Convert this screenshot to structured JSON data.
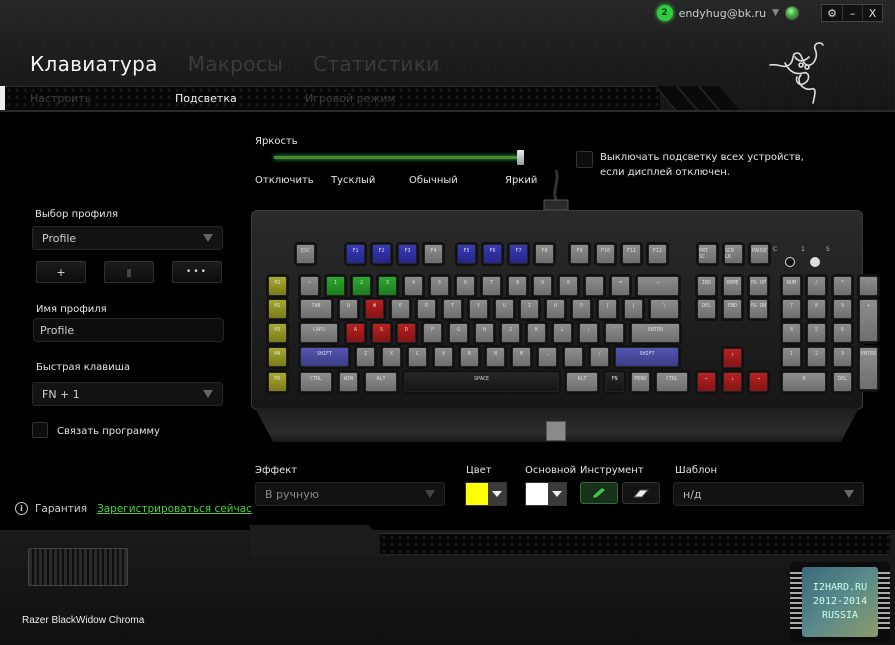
{
  "topbar": {
    "notification_count": "2",
    "account_email": "endyhug@bk.ru",
    "settings_icon": "gear-icon",
    "minimize_label": "–",
    "close_label": "X"
  },
  "main_tabs": [
    {
      "label": "Клавиатура",
      "active": true
    },
    {
      "label": "Макросы",
      "active": false
    },
    {
      "label": "Статистики",
      "active": false
    }
  ],
  "sub_tabs": [
    {
      "label": "Настроить",
      "active": false
    },
    {
      "label": "Подсветка",
      "active": true
    },
    {
      "label": "Игровой режим",
      "active": false
    }
  ],
  "brightness": {
    "label": "Яркость",
    "level_percent": 100,
    "marks": [
      "Отключить",
      "Тусклый",
      "Обычный",
      "Яркий"
    ]
  },
  "display_off_option": {
    "label": "Выключать подсветку всех устройств, если дисплей отключен.",
    "checked": false
  },
  "profile": {
    "select_label": "Выбор профиля",
    "selected": "Profile",
    "add_label": "+",
    "delete_icon": "trash-icon",
    "more_label": "•••",
    "name_label": "Имя профиля",
    "name_value": "Profile",
    "hotkey_label": "Быстрая клавиша",
    "hotkey_value": "FN + 1",
    "link_program_label": "Связать программу",
    "link_program_checked": false
  },
  "effect": {
    "label": "Эффект",
    "value": "В ручную"
  },
  "color": {
    "label": "Цвет",
    "value": "#ffff00"
  },
  "base": {
    "label": "Основной",
    "value": "#ffffff"
  },
  "tool": {
    "label": "Инструмент",
    "items": [
      "pencil-icon",
      "eraser-icon"
    ],
    "active": "pencil-icon"
  },
  "template": {
    "label": "Шаблон",
    "value": "н/д"
  },
  "warranty": {
    "label": "Гарантия",
    "link": "Зарегистрироваться сейчас"
  },
  "device": {
    "name": "Razer BlackWidow Chroma"
  },
  "keyboard": {
    "led_labels": [
      "C",
      "1",
      "S"
    ],
    "key_colors": {
      "blue": "#3030a8",
      "green": "#22a022",
      "red": "#b01818",
      "yellow": "#a0a020",
      "purple": "#4a4aa0",
      "default": "#7a7a7a"
    },
    "rows": [
      [
        {
          "k": "ESC",
          "c": "gray"
        },
        {
          "k": "F1",
          "c": "blue"
        },
        {
          "k": "F2",
          "c": "blue"
        },
        {
          "k": "F3",
          "c": "blue"
        },
        {
          "k": "F4",
          "c": "gray"
        },
        {
          "k": "F5",
          "c": "blue"
        },
        {
          "k": "F6",
          "c": "blue"
        },
        {
          "k": "F7",
          "c": "blue"
        },
        {
          "k": "F8",
          "c": "gray"
        },
        {
          "k": "F9",
          "c": "gray"
        },
        {
          "k": "F10",
          "c": "gray"
        },
        {
          "k": "F11",
          "c": "gray"
        },
        {
          "k": "F12",
          "c": "gray"
        },
        {
          "k": "PRT SC",
          "c": "gray"
        },
        {
          "k": "SCR LK",
          "c": "gray"
        },
        {
          "k": "PAUSE",
          "c": "gray"
        }
      ],
      [
        {
          "k": "M1",
          "c": "yellow"
        },
        {
          "k": "~",
          "c": "gray"
        },
        {
          "k": "1",
          "c": "green"
        },
        {
          "k": "2",
          "c": "green"
        },
        {
          "k": "3",
          "c": "green"
        },
        {
          "k": "4",
          "c": "gray"
        },
        {
          "k": "5",
          "c": "gray"
        },
        {
          "k": "6",
          "c": "gray"
        },
        {
          "k": "7",
          "c": "gray"
        },
        {
          "k": "8",
          "c": "gray"
        },
        {
          "k": "9",
          "c": "gray"
        },
        {
          "k": "0",
          "c": "gray"
        },
        {
          "k": "-",
          "c": "gray"
        },
        {
          "k": "=",
          "c": "gray"
        },
        {
          "k": "←",
          "c": "gray"
        },
        {
          "k": "INS",
          "c": "gray"
        },
        {
          "k": "HOME",
          "c": "gray"
        },
        {
          "k": "PG UP",
          "c": "gray"
        },
        {
          "k": "NUM",
          "c": "gray"
        },
        {
          "k": "/",
          "c": "gray"
        },
        {
          "k": "*",
          "c": "gray"
        },
        {
          "k": "-",
          "c": "gray"
        }
      ],
      [
        {
          "k": "M2",
          "c": "yellow"
        },
        {
          "k": "TAB",
          "c": "gray"
        },
        {
          "k": "Q",
          "c": "gray"
        },
        {
          "k": "W",
          "c": "red"
        },
        {
          "k": "E",
          "c": "gray"
        },
        {
          "k": "R",
          "c": "gray"
        },
        {
          "k": "T",
          "c": "gray"
        },
        {
          "k": "Y",
          "c": "gray"
        },
        {
          "k": "U",
          "c": "gray"
        },
        {
          "k": "I",
          "c": "gray"
        },
        {
          "k": "O",
          "c": "gray"
        },
        {
          "k": "P",
          "c": "gray"
        },
        {
          "k": "[",
          "c": "gray"
        },
        {
          "k": "]",
          "c": "gray"
        },
        {
          "k": "\\",
          "c": "gray"
        },
        {
          "k": "DEL",
          "c": "gray"
        },
        {
          "k": "END",
          "c": "gray"
        },
        {
          "k": "PG DN",
          "c": "gray"
        },
        {
          "k": "7",
          "c": "gray"
        },
        {
          "k": "8",
          "c": "gray"
        },
        {
          "k": "9",
          "c": "gray"
        },
        {
          "k": "+",
          "c": "gray"
        }
      ],
      [
        {
          "k": "M3",
          "c": "yellow"
        },
        {
          "k": "CAPS",
          "c": "gray"
        },
        {
          "k": "A",
          "c": "red"
        },
        {
          "k": "S",
          "c": "red"
        },
        {
          "k": "D",
          "c": "red"
        },
        {
          "k": "F",
          "c": "gray"
        },
        {
          "k": "G",
          "c": "gray"
        },
        {
          "k": "H",
          "c": "gray"
        },
        {
          "k": "J",
          "c": "gray"
        },
        {
          "k": "K",
          "c": "gray"
        },
        {
          "k": "L",
          "c": "gray"
        },
        {
          "k": ";",
          "c": "gray"
        },
        {
          "k": "'",
          "c": "gray"
        },
        {
          "k": "ENTER",
          "c": "gray"
        },
        {
          "k": "4",
          "c": "gray"
        },
        {
          "k": "5",
          "c": "gray"
        },
        {
          "k": "6",
          "c": "gray"
        }
      ],
      [
        {
          "k": "M4",
          "c": "yellow"
        },
        {
          "k": "SHIFT",
          "c": "purple"
        },
        {
          "k": "Z",
          "c": "gray"
        },
        {
          "k": "X",
          "c": "gray"
        },
        {
          "k": "C",
          "c": "gray"
        },
        {
          "k": "V",
          "c": "gray"
        },
        {
          "k": "B",
          "c": "gray"
        },
        {
          "k": "N",
          "c": "gray"
        },
        {
          "k": "M",
          "c": "gray"
        },
        {
          "k": ",",
          "c": "gray"
        },
        {
          "k": ".",
          "c": "gray"
        },
        {
          "k": "/",
          "c": "gray"
        },
        {
          "k": "SHIFT",
          "c": "purple"
        },
        {
          "k": "↑",
          "c": "red"
        },
        {
          "k": "1",
          "c": "gray"
        },
        {
          "k": "2",
          "c": "gray"
        },
        {
          "k": "3",
          "c": "gray"
        },
        {
          "k": "ENTER",
          "c": "gray"
        }
      ],
      [
        {
          "k": "M5",
          "c": "yellow"
        },
        {
          "k": "CTRL",
          "c": "gray"
        },
        {
          "k": "WIN",
          "c": "gray"
        },
        {
          "k": "ALT",
          "c": "gray"
        },
        {
          "k": "SPACE",
          "c": "dark"
        },
        {
          "k": "ALT",
          "c": "gray"
        },
        {
          "k": "FN",
          "c": "dark"
        },
        {
          "k": "MENU",
          "c": "gray"
        },
        {
          "k": "CTRL",
          "c": "gray"
        },
        {
          "k": "←",
          "c": "red"
        },
        {
          "k": "↓",
          "c": "red"
        },
        {
          "k": "→",
          "c": "red"
        },
        {
          "k": "0",
          "c": "gray"
        },
        {
          "k": "DEL",
          "c": "gray"
        }
      ]
    ]
  },
  "watermark": {
    "line1": "I2HARD.RU",
    "line2": "2012-2014",
    "line3": "RUSSIA"
  }
}
